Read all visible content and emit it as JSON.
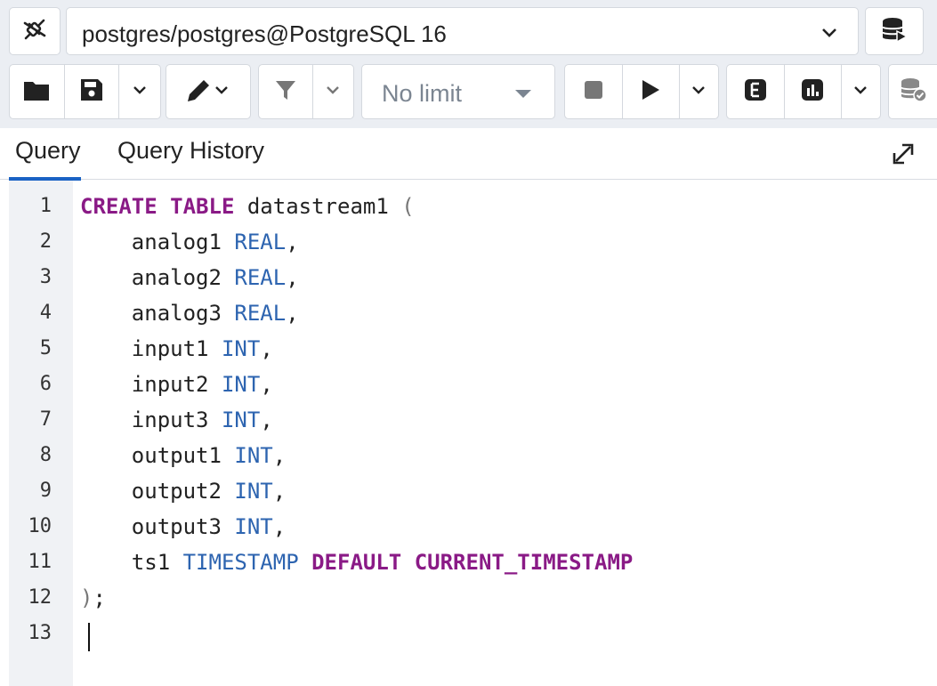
{
  "connection": {
    "label": "postgres/postgres@PostgreSQL 16",
    "icon": "connection-plug-icon",
    "server_icon": "database-server-icon"
  },
  "toolbar": {
    "buttons": [
      {
        "name": "open-file",
        "icon": "folder-icon"
      },
      {
        "name": "save-file",
        "icon": "save-icon"
      },
      {
        "name": "save-options",
        "icon": "chevron-down-icon"
      },
      {
        "name": "edit",
        "icon": "pencil-icon"
      },
      {
        "name": "filter",
        "icon": "filter-icon"
      },
      {
        "name": "filter-options",
        "icon": "chevron-down-icon"
      },
      {
        "name": "stop",
        "icon": "stop-icon"
      },
      {
        "name": "execute",
        "icon": "play-icon"
      },
      {
        "name": "execute-options",
        "icon": "chevron-down-icon"
      },
      {
        "name": "explain",
        "icon": "explain-icon"
      },
      {
        "name": "explain-analyze",
        "icon": "bar-chart-icon"
      },
      {
        "name": "explain-options",
        "icon": "chevron-down-icon"
      },
      {
        "name": "commit",
        "icon": "database-check-icon"
      }
    ],
    "limit": {
      "value": "No limit"
    }
  },
  "tabs": [
    {
      "label": "Query",
      "active": true
    },
    {
      "label": "Query History",
      "active": false
    }
  ],
  "editor": {
    "line_numbers": [
      "1",
      "2",
      "3",
      "4",
      "5",
      "6",
      "7",
      "8",
      "9",
      "10",
      "11",
      "12",
      "13"
    ],
    "lines": [
      [
        {
          "t": "CREATE",
          "c": "kw"
        },
        {
          "t": " ",
          "c": "plain"
        },
        {
          "t": "TABLE",
          "c": "kw"
        },
        {
          "t": " datastream1 ",
          "c": "plain"
        },
        {
          "t": "(",
          "c": "punct"
        }
      ],
      [
        {
          "t": "    analog1 ",
          "c": "plain"
        },
        {
          "t": "REAL",
          "c": "type"
        },
        {
          "t": ",",
          "c": "plain"
        }
      ],
      [
        {
          "t": "    analog2 ",
          "c": "plain"
        },
        {
          "t": "REAL",
          "c": "type"
        },
        {
          "t": ",",
          "c": "plain"
        }
      ],
      [
        {
          "t": "    analog3 ",
          "c": "plain"
        },
        {
          "t": "REAL",
          "c": "type"
        },
        {
          "t": ",",
          "c": "plain"
        }
      ],
      [
        {
          "t": "    input1 ",
          "c": "plain"
        },
        {
          "t": "INT",
          "c": "type"
        },
        {
          "t": ",",
          "c": "plain"
        }
      ],
      [
        {
          "t": "    input2 ",
          "c": "plain"
        },
        {
          "t": "INT",
          "c": "type"
        },
        {
          "t": ",",
          "c": "plain"
        }
      ],
      [
        {
          "t": "    input3 ",
          "c": "plain"
        },
        {
          "t": "INT",
          "c": "type"
        },
        {
          "t": ",",
          "c": "plain"
        }
      ],
      [
        {
          "t": "    output1 ",
          "c": "plain"
        },
        {
          "t": "INT",
          "c": "type"
        },
        {
          "t": ",",
          "c": "plain"
        }
      ],
      [
        {
          "t": "    output2 ",
          "c": "plain"
        },
        {
          "t": "INT",
          "c": "type"
        },
        {
          "t": ",",
          "c": "plain"
        }
      ],
      [
        {
          "t": "    output3 ",
          "c": "plain"
        },
        {
          "t": "INT",
          "c": "type"
        },
        {
          "t": ",",
          "c": "plain"
        }
      ],
      [
        {
          "t": "    ts1 ",
          "c": "plain"
        },
        {
          "t": "TIMESTAMP",
          "c": "type"
        },
        {
          "t": " ",
          "c": "plain"
        },
        {
          "t": "DEFAULT",
          "c": "kw"
        },
        {
          "t": " ",
          "c": "plain"
        },
        {
          "t": "CURRENT_TIMESTAMP",
          "c": "kw"
        }
      ],
      [
        {
          "t": ")",
          "c": "punct"
        },
        {
          "t": ";",
          "c": "plain"
        }
      ],
      []
    ]
  },
  "colors": {
    "keyword": "#8a1a86",
    "type": "#2d64b0",
    "accent": "#1a62c4",
    "toolbar_bg": "#ebeef3"
  }
}
